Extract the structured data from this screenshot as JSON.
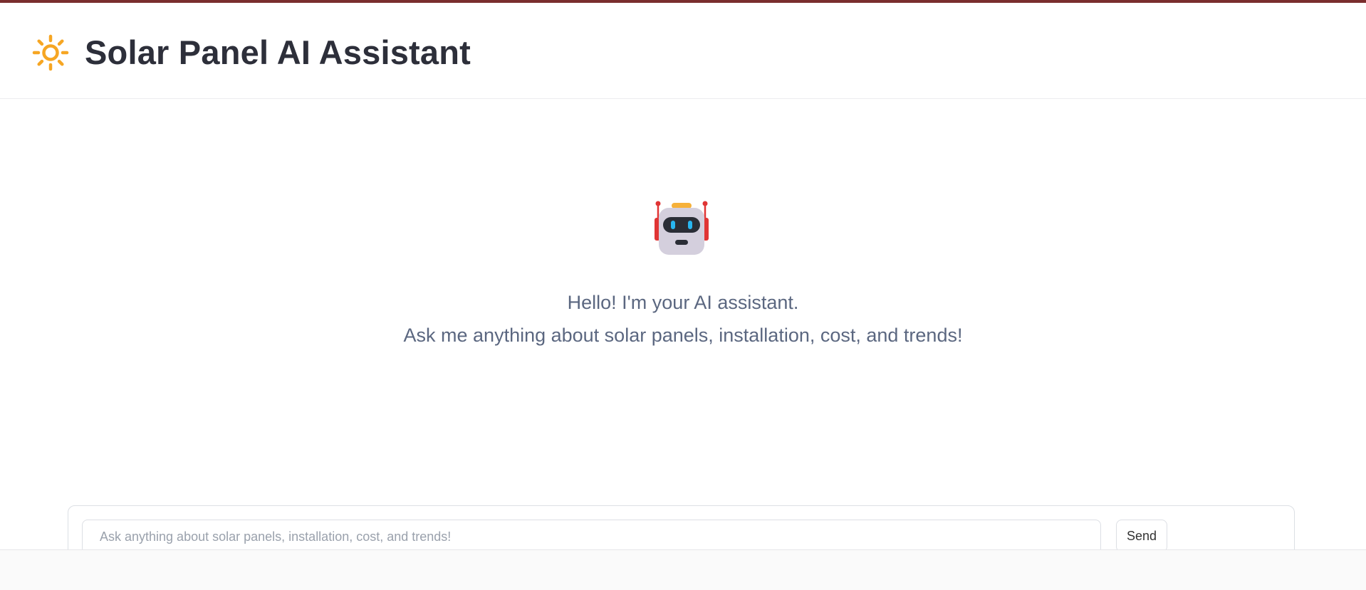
{
  "app": {
    "title": "Solar Panel AI Assistant",
    "icon": "sun-icon",
    "accent_color": "#f6a623"
  },
  "welcome": {
    "icon": "robot-icon",
    "line1": "Hello! I'm your AI assistant.",
    "line2": "Ask me anything about solar panels, installation, cost, and trends!"
  },
  "composer": {
    "placeholder": "Ask anything about solar panels, installation, cost, and trends!",
    "value": "",
    "send_label": "Send"
  },
  "colors": {
    "top_strip": "#7a2e2e",
    "title_text": "#2d2f3a",
    "welcome_text": "#5b6780"
  }
}
